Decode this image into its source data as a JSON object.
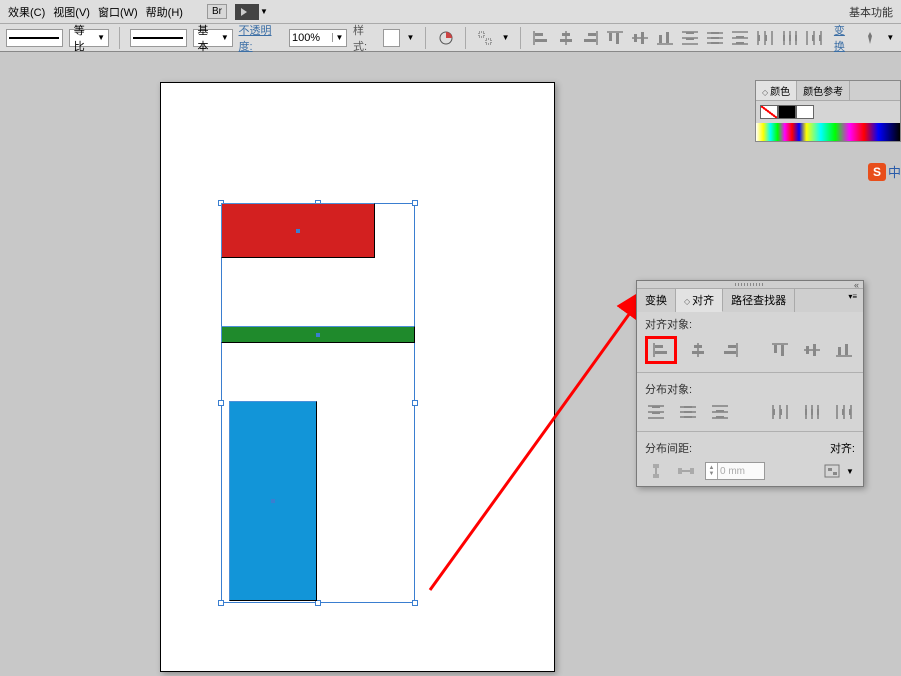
{
  "menubar": {
    "effect": "效果(C)",
    "view": "视图(V)",
    "window": "窗口(W)",
    "help": "帮助(H)",
    "br": "Br",
    "workspace": "基本功能"
  },
  "optionsbar": {
    "proportional": "等比",
    "basic": "基本",
    "opacity_label": "不透明度:",
    "opacity_value": "100%",
    "style_label": "样式:",
    "transform": "变换"
  },
  "color_panel": {
    "tab_color": "颜色",
    "tab_guide": "颜色参考"
  },
  "ime": {
    "s": "S",
    "zh": "中"
  },
  "align_panel": {
    "tab_transform": "变换",
    "tab_align": "对齐",
    "tab_pathfinder": "路径查找器",
    "section_align": "对齐对象:",
    "section_distribute": "分布对象:",
    "section_spacing": "分布间距:",
    "align_to": "对齐:",
    "mm_value": "0 mm"
  }
}
